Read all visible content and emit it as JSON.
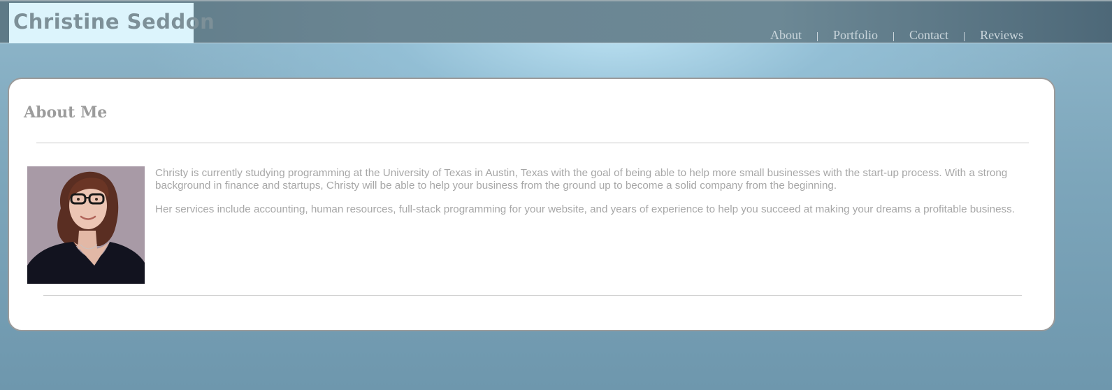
{
  "header": {
    "brand": "Christine Seddon",
    "nav": [
      {
        "label": "About"
      },
      {
        "label": "Portfolio"
      },
      {
        "label": "Contact"
      },
      {
        "label": "Reviews"
      }
    ],
    "separator": "|"
  },
  "about": {
    "title": "About Me",
    "paragraphs": [
      "Christy is currently studying programming at the University of Texas in Austin, Texas with the goal of being able to help more small businesses with the start-up process. With a strong background in finance and startups, Christy will be able to help your business from the ground up to become a solid company from the beginning.",
      "Her services include accounting, human resources, full-stack programming for your website, and years of experience to help you succeed at making your dreams a profitable business."
    ]
  },
  "colors": {
    "header_bar": "#6a8592",
    "logo_background": "#dcf4fc",
    "logo_text": "#7d9098",
    "nav_text": "#c9d5db",
    "card_background": "#ffffff",
    "card_border": "#9b9b9b",
    "body_text": "#a7a7a7",
    "heading_text": "#9c9c9c"
  }
}
